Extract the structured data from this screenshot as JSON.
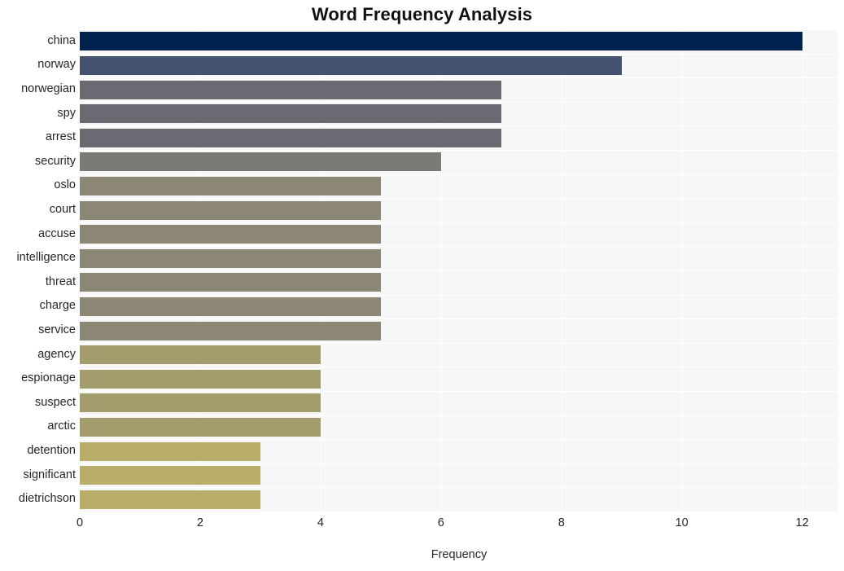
{
  "chart_data": {
    "type": "bar",
    "orientation": "horizontal",
    "title": "Word Frequency Analysis",
    "xlabel": "Frequency",
    "ylabel": "",
    "categories": [
      "china",
      "norway",
      "norwegian",
      "spy",
      "arrest",
      "security",
      "oslo",
      "court",
      "accuse",
      "intelligence",
      "threat",
      "charge",
      "service",
      "agency",
      "espionage",
      "suspect",
      "arctic",
      "detention",
      "significant",
      "dietrichson"
    ],
    "values": [
      12,
      9,
      7,
      7,
      7,
      6,
      5,
      5,
      5,
      5,
      5,
      5,
      5,
      4,
      4,
      4,
      4,
      3,
      3,
      3
    ],
    "bar_colors": [
      "#00224e",
      "#44516f",
      "#6a6a72",
      "#6a6a72",
      "#6a6a72",
      "#7b7a75",
      "#8c8775",
      "#8c8775",
      "#8c8775",
      "#8c8775",
      "#8c8775",
      "#8c8775",
      "#8c8775",
      "#a39d6e",
      "#a39d6e",
      "#a39d6e",
      "#a39d6e",
      "#b9ad6a",
      "#b9ad6a",
      "#b9ad6a"
    ],
    "xlim": [
      0,
      12.6
    ],
    "xticks": [
      0,
      2,
      4,
      6,
      8,
      10,
      12
    ],
    "xtick_labels": [
      "0",
      "2",
      "4",
      "6",
      "8",
      "10",
      "12"
    ],
    "grid": true,
    "grid_color": "#ffffff",
    "plot_background": "#f7f7f7",
    "legend": null
  }
}
